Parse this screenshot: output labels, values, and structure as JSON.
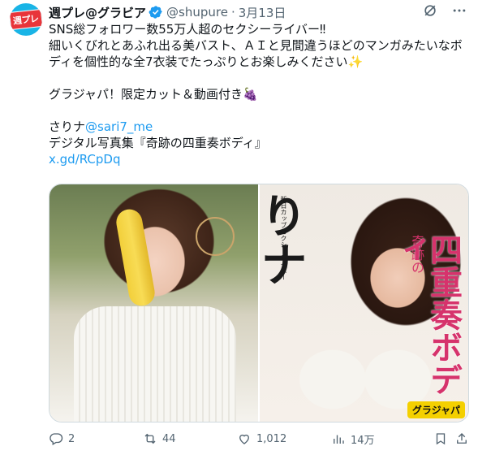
{
  "tweet": {
    "display_name": "週プレ@グラビア",
    "handle": "@shupure",
    "separator": "·",
    "date": "3月13日",
    "avatar_text": "週プレ",
    "body": {
      "line1": "SNS総フォロワー数55万人超のセクシーライバー‼",
      "line2": "細いくびれとあふれ出る美バスト、ＡＩと見間違うほどのマンガみたいなボ",
      "line3": "ディを個性的な全7衣装でたっぷりとお楽しみください✨",
      "line4": "グラジャパ！限定カット＆動画付き🍇",
      "line5_prefix": "さりナ",
      "mention": "@sari7_me",
      "line6": "デジタル写真集『奇跡の四重奏ボディ』",
      "url": "x.gd/RCpDq"
    },
    "cover": {
      "name": "りナ",
      "subtitle": "新日カップセクシーライバー",
      "title_small": "奇跡の",
      "title": "四重奏ボディ",
      "badge": "グラジャパ"
    },
    "stats": {
      "replies": "2",
      "retweets": "44",
      "likes": "1,012",
      "views": "14万"
    }
  },
  "colors": {
    "link": "#1d9bf0",
    "muted": "#536471",
    "accent_cover": "#d6336c"
  },
  "icons": [
    "verified-icon",
    "grok-icon",
    "more-icon",
    "reply-icon",
    "retweet-icon",
    "like-icon",
    "views-icon",
    "bookmark-icon",
    "share-icon"
  ]
}
